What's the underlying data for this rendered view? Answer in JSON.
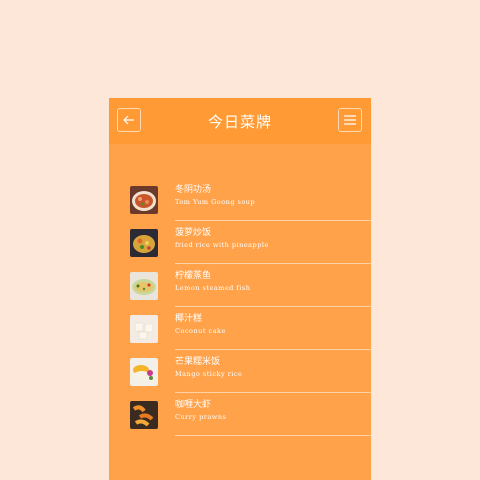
{
  "header": {
    "title": "今日菜牌",
    "back_icon": "arrow-left-icon",
    "menu_icon": "hamburger-menu-icon"
  },
  "colors": {
    "background": "#fde7d8",
    "panel": "#ffa24a",
    "header": "#ff9a35",
    "text": "#ffffff"
  },
  "menu_items": [
    {
      "name_cn": "冬阴功汤",
      "name_en": "Tom Yum Goong soup",
      "image": "tom-yum-soup-photo"
    },
    {
      "name_cn": "菠萝炒饭",
      "name_en": "fried rice with pineapple",
      "image": "pineapple-fried-rice-photo"
    },
    {
      "name_cn": "柠檬蒸鱼",
      "name_en": "Lemon steamed fish",
      "image": "lemon-steamed-fish-photo"
    },
    {
      "name_cn": "椰汁糕",
      "name_en": "Coconut cake",
      "image": "coconut-cake-photo"
    },
    {
      "name_cn": "芒果糯米饭",
      "name_en": "Mango sticky rice",
      "image": "mango-sticky-rice-photo"
    },
    {
      "name_cn": "咖喱大虾",
      "name_en": "Curry prawns",
      "image": "curry-prawns-photo"
    }
  ]
}
